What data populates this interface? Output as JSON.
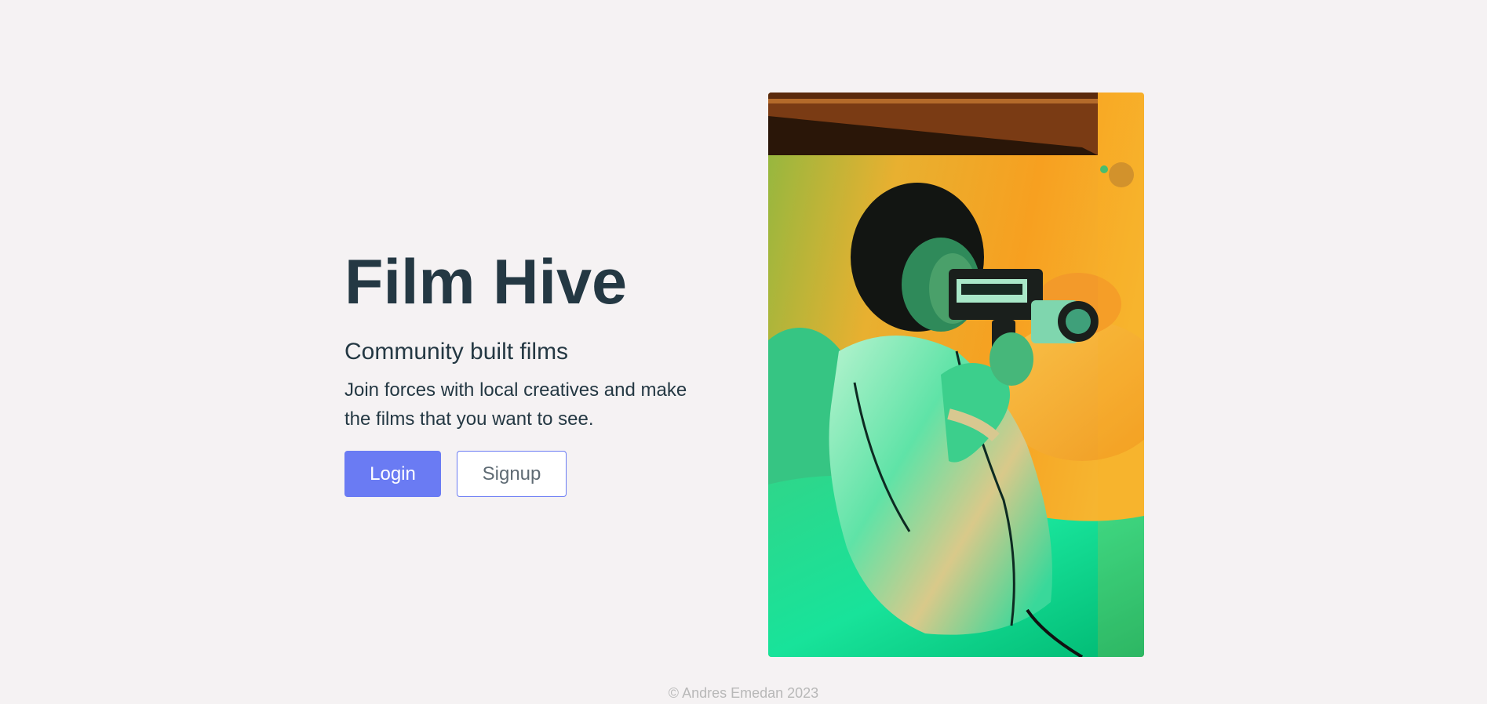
{
  "hero": {
    "title": "Film Hive",
    "subtitle": "Community built films",
    "description": "Join forces with local creatives and make the films that you want to see.",
    "login_label": "Login",
    "signup_label": "Signup"
  },
  "footer": {
    "copyright": "© Andres Emedan 2023"
  },
  "colors": {
    "background": "#f5f2f3",
    "text": "#243843",
    "accent": "#6a7bf3",
    "footer_text": "#b8b8b8"
  }
}
